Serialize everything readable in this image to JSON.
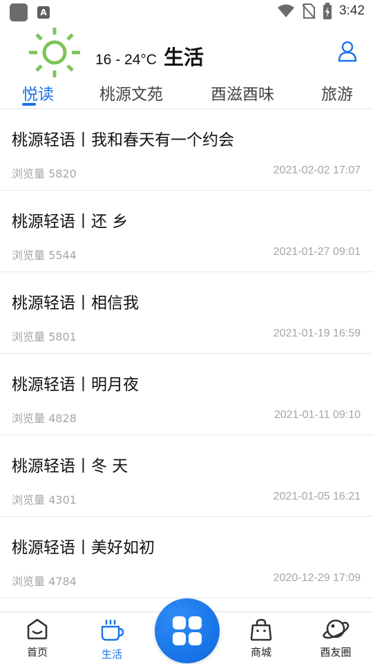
{
  "status_bar": {
    "time": "3:42",
    "icons": [
      "app-icon",
      "a-icon",
      "wifi-icon",
      "no-sim-icon",
      "battery-icon"
    ]
  },
  "header": {
    "temperature": "16 - 24°C",
    "title": "生活",
    "weather_icon": "sun-icon",
    "user_icon": "user-icon",
    "accent_color": "#1a73e8",
    "sun_color": "#7cc55a"
  },
  "tabs": [
    {
      "label": "悦读",
      "active": true
    },
    {
      "label": "桃源文苑",
      "active": false
    },
    {
      "label": "酉滋酉味",
      "active": false
    },
    {
      "label": "旅游",
      "active": false
    }
  ],
  "articles": [
    {
      "title": "桃源轻语丨我和春天有一个约会",
      "views": "浏览量 5820",
      "date": "2021-02-02 17:07"
    },
    {
      "title": "桃源轻语丨还 乡",
      "views": "浏览量 5544",
      "date": "2021-01-27 09:01"
    },
    {
      "title": "桃源轻语丨相信我",
      "views": "浏览量 5801",
      "date": "2021-01-19 16:59"
    },
    {
      "title": "桃源轻语丨明月夜",
      "views": "浏览量 4828",
      "date": "2021-01-11 09:10"
    },
    {
      "title": "桃源轻语丨冬 天",
      "views": "浏览量 4301",
      "date": "2021-01-05 16:21"
    },
    {
      "title": "桃源轻语丨美好如初",
      "views": "浏览量 4784",
      "date": "2020-12-29 17:09"
    }
  ],
  "bottom_nav": [
    {
      "label": "首页",
      "icon": "home-icon",
      "active": false
    },
    {
      "label": "生活",
      "icon": "coffee-cup-icon",
      "active": true
    },
    {
      "label": "",
      "icon": "apps-grid-icon",
      "active": false
    },
    {
      "label": "商城",
      "icon": "shopping-bag-icon",
      "active": false
    },
    {
      "label": "酉友圈",
      "icon": "planet-icon",
      "active": false
    }
  ]
}
